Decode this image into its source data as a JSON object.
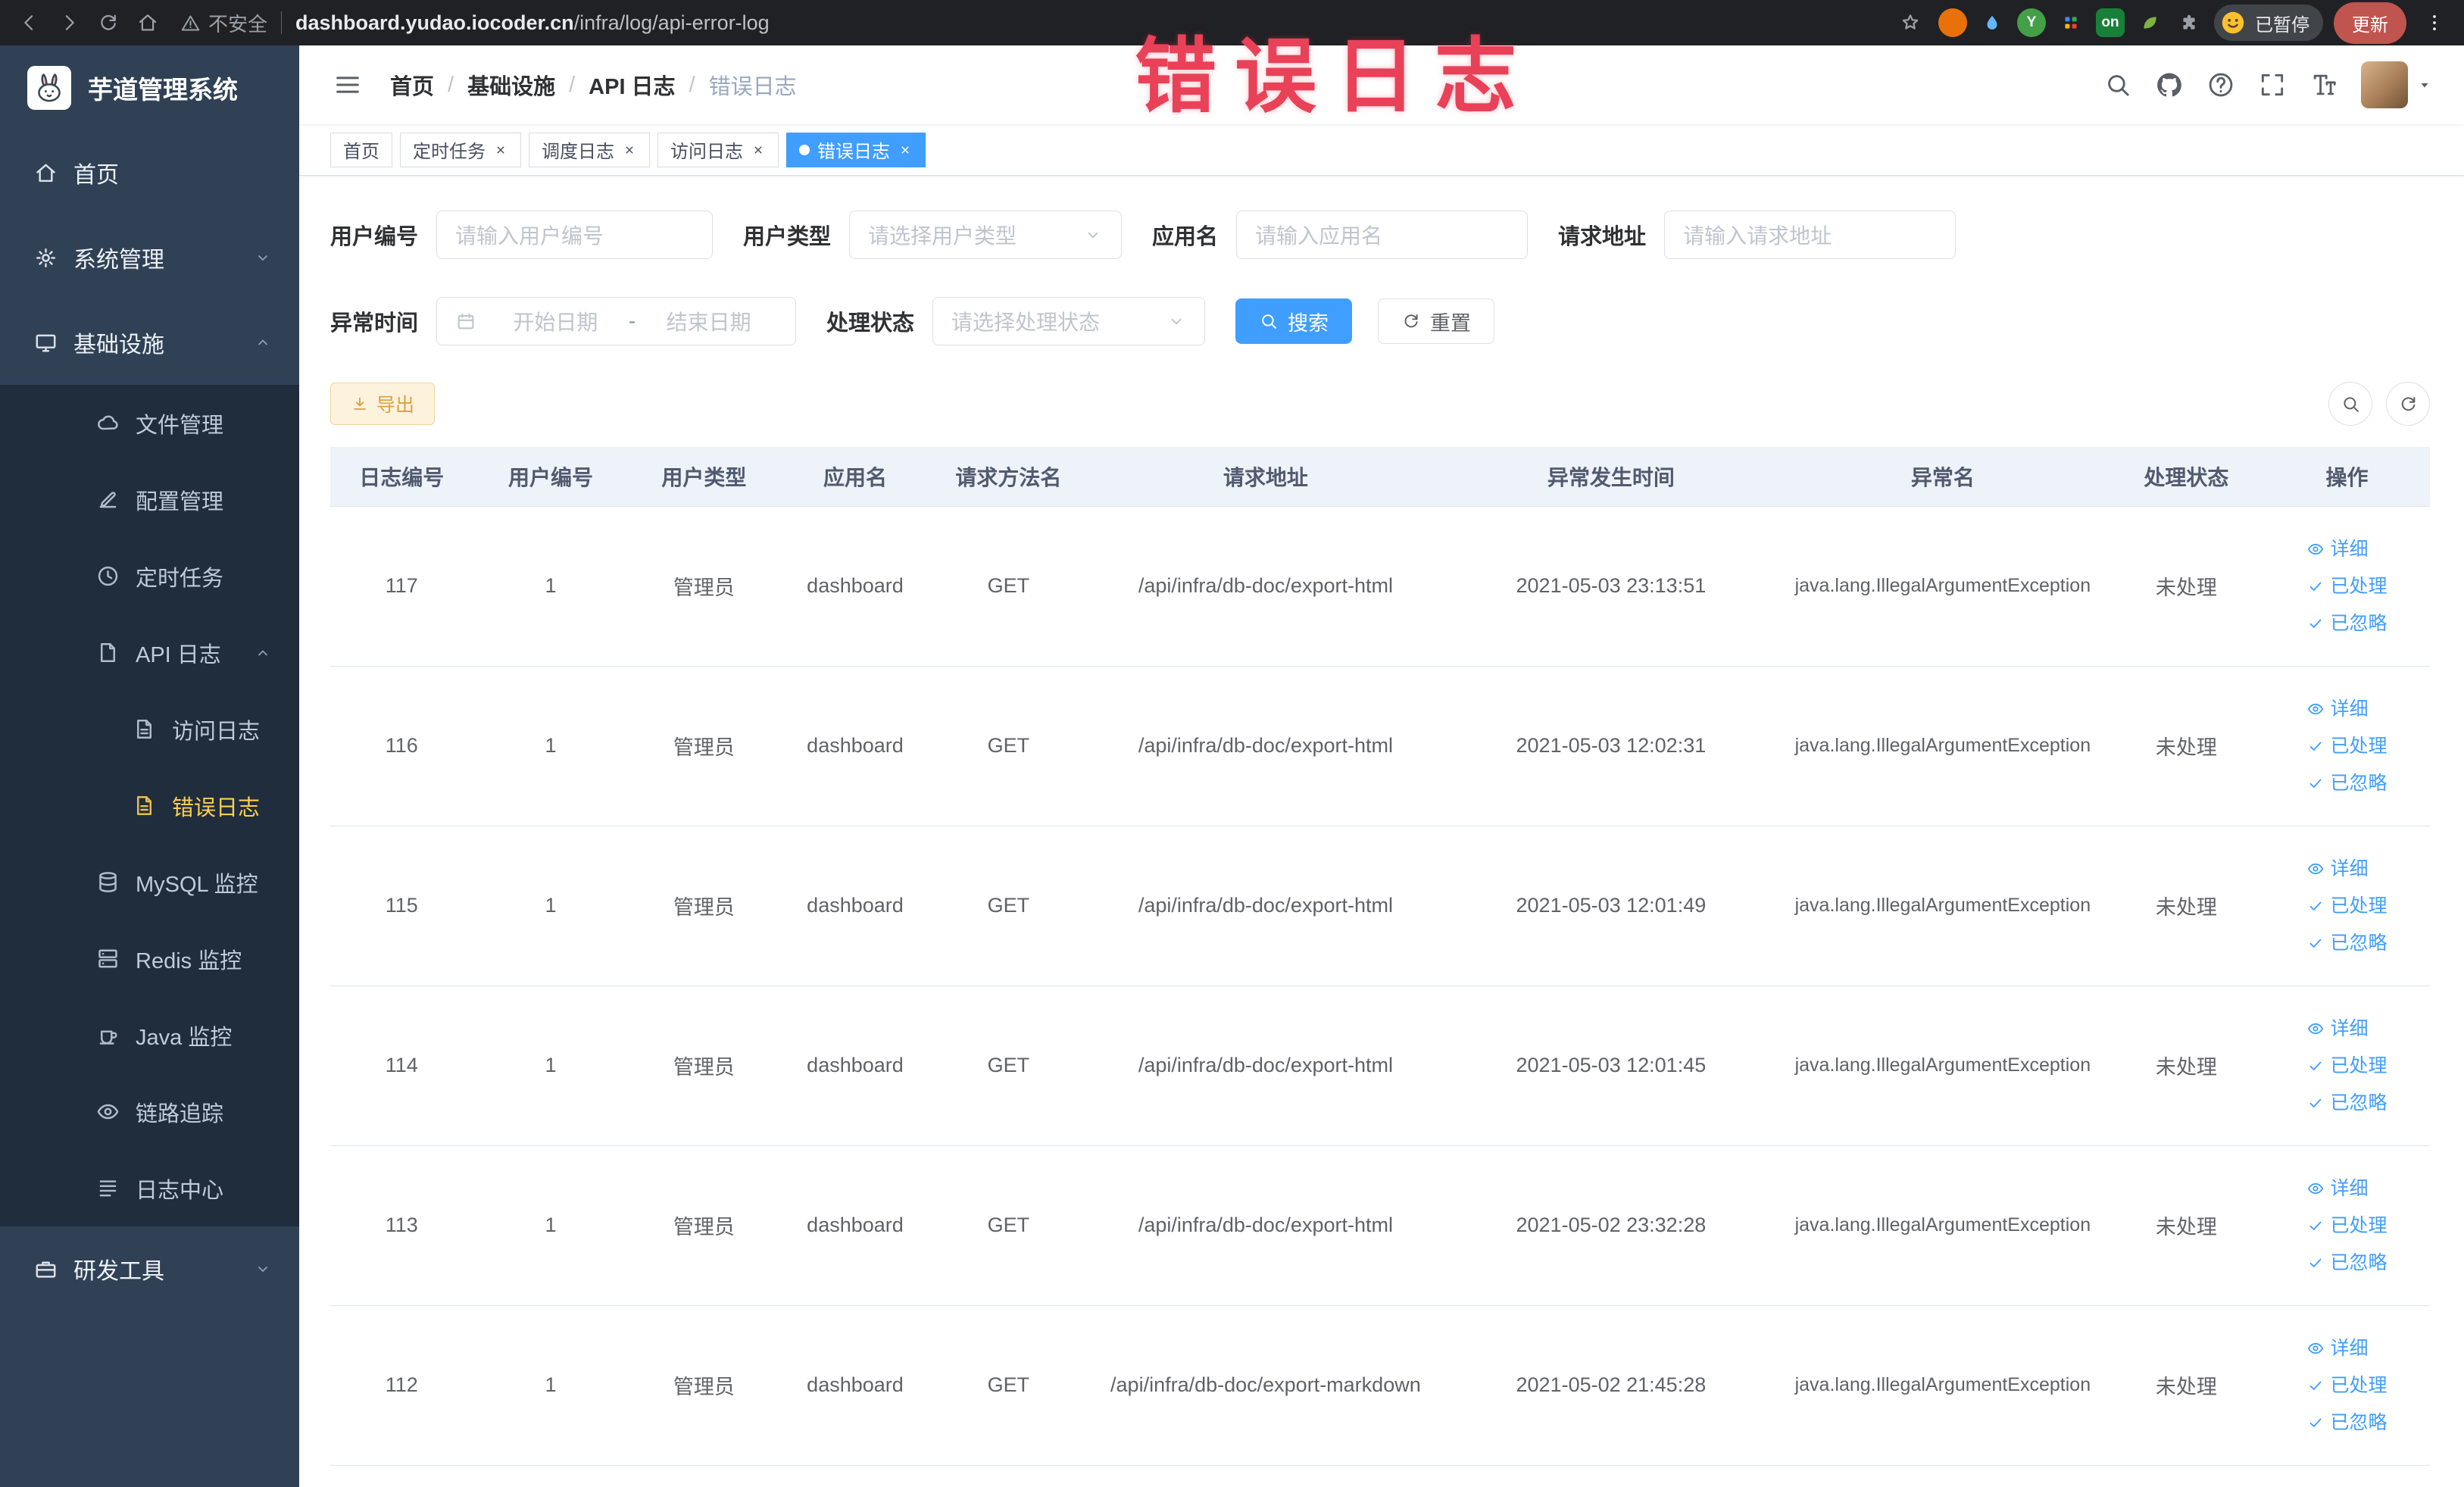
{
  "chrome": {
    "security_label": "不安全",
    "url_domain": "dashboard.yudao.iocoder.cn",
    "url_path": "/infra/log/api-error-log",
    "paused_badge": "已暂停",
    "update_label": "更新"
  },
  "watermark": {
    "text": "错误日志",
    "color": "#e94158"
  },
  "sidebar": {
    "title": "芋道管理系统",
    "items": [
      {
        "key": "home",
        "label": "首页",
        "icon": "home-icon",
        "level": 0
      },
      {
        "key": "system",
        "label": "系统管理",
        "icon": "gear-icon",
        "level": 0,
        "chevron": "down"
      },
      {
        "key": "infrastructure",
        "label": "基础设施",
        "icon": "monitor-icon",
        "level": 0,
        "chevron": "up"
      },
      {
        "key": "file",
        "label": "文件管理",
        "icon": "cloud-icon",
        "level": 1
      },
      {
        "key": "config",
        "label": "配置管理",
        "icon": "edit-icon",
        "level": 1
      },
      {
        "key": "job",
        "label": "定时任务",
        "icon": "clock-icon",
        "level": 1
      },
      {
        "key": "api-log",
        "label": "API 日志",
        "icon": "doc-icon",
        "level": 1,
        "chevron": "up"
      },
      {
        "key": "access-log",
        "label": "访问日志",
        "icon": "doc-lines-icon",
        "level": 2
      },
      {
        "key": "error-log",
        "label": "错误日志",
        "icon": "doc-lines-icon",
        "level": 2,
        "active": true
      },
      {
        "key": "mysql",
        "label": "MySQL 监控",
        "icon": "database-icon",
        "level": 1
      },
      {
        "key": "redis",
        "label": "Redis 监控",
        "icon": "redis-icon",
        "level": 1
      },
      {
        "key": "java",
        "label": "Java 监控",
        "icon": "java-icon",
        "level": 1
      },
      {
        "key": "trace",
        "label": "链路追踪",
        "icon": "eye-icon",
        "level": 1
      },
      {
        "key": "log-center",
        "label": "日志中心",
        "icon": "list-icon",
        "level": 1
      },
      {
        "key": "dev-tools",
        "label": "研发工具",
        "icon": "toolbox-icon",
        "level": 0,
        "chevron": "down"
      }
    ]
  },
  "navbar": {
    "breadcrumb": [
      "首页",
      "基础设施",
      "API 日志",
      "错误日志"
    ]
  },
  "tags": [
    {
      "key": "home",
      "label": "首页",
      "closable": false,
      "active": false
    },
    {
      "key": "job",
      "label": "定时任务",
      "closable": true,
      "active": false
    },
    {
      "key": "job-log",
      "label": "调度日志",
      "closable": true,
      "active": false
    },
    {
      "key": "access-log",
      "label": "访问日志",
      "closable": true,
      "active": false
    },
    {
      "key": "error-log",
      "label": "错误日志",
      "closable": true,
      "active": true
    }
  ],
  "filters": {
    "fields": [
      {
        "key": "userId",
        "label": "用户编号",
        "type": "input",
        "placeholder": "请输入用户编号"
      },
      {
        "key": "userType",
        "label": "用户类型",
        "type": "select",
        "placeholder": "请选择用户类型"
      },
      {
        "key": "appName",
        "label": "应用名",
        "type": "input",
        "placeholder": "请输入应用名"
      },
      {
        "key": "reqUrl",
        "label": "请求地址",
        "type": "input",
        "placeholder": "请输入请求地址"
      },
      {
        "key": "time",
        "label": "异常时间",
        "type": "daterange",
        "start_placeholder": "开始日期",
        "separator": "-",
        "end_placeholder": "结束日期"
      },
      {
        "key": "status",
        "label": "处理状态",
        "type": "select",
        "placeholder": "请选择处理状态"
      }
    ],
    "search_label": "搜索",
    "reset_label": "重置"
  },
  "toolbar": {
    "export_label": "导出"
  },
  "table": {
    "columns": [
      "日志编号",
      "用户编号",
      "用户类型",
      "应用名",
      "请求方法名",
      "请求地址",
      "异常发生时间",
      "异常名",
      "处理状态",
      "操作"
    ],
    "col_keys": [
      "id",
      "user_id",
      "user_type",
      "app",
      "method",
      "url",
      "time",
      "exception",
      "status"
    ],
    "rows": [
      {
        "id": "117",
        "user_id": "1",
        "user_type": "管理员",
        "app": "dashboard",
        "method": "GET",
        "url": "/api/infra/db-doc/export-html",
        "time": "2021-05-03 23:13:51",
        "exception": "java.lang.IllegalArgumentException",
        "status": "未处理"
      },
      {
        "id": "116",
        "user_id": "1",
        "user_type": "管理员",
        "app": "dashboard",
        "method": "GET",
        "url": "/api/infra/db-doc/export-html",
        "time": "2021-05-03 12:02:31",
        "exception": "java.lang.IllegalArgumentException",
        "status": "未处理"
      },
      {
        "id": "115",
        "user_id": "1",
        "user_type": "管理员",
        "app": "dashboard",
        "method": "GET",
        "url": "/api/infra/db-doc/export-html",
        "time": "2021-05-03 12:01:49",
        "exception": "java.lang.IllegalArgumentException",
        "status": "未处理"
      },
      {
        "id": "114",
        "user_id": "1",
        "user_type": "管理员",
        "app": "dashboard",
        "method": "GET",
        "url": "/api/infra/db-doc/export-html",
        "time": "2021-05-03 12:01:45",
        "exception": "java.lang.IllegalArgumentException",
        "status": "未处理"
      },
      {
        "id": "113",
        "user_id": "1",
        "user_type": "管理员",
        "app": "dashboard",
        "method": "GET",
        "url": "/api/infra/db-doc/export-html",
        "time": "2021-05-02 23:32:28",
        "exception": "java.lang.IllegalArgumentException",
        "status": "未处理"
      },
      {
        "id": "112",
        "user_id": "1",
        "user_type": "管理员",
        "app": "dashboard",
        "method": "GET",
        "url": "/api/infra/db-doc/export-markdown",
        "time": "2021-05-02 21:45:28",
        "exception": "java.lang.IllegalArgumentException",
        "status": "未处理"
      }
    ],
    "row_actions": [
      {
        "key": "detail",
        "label": "详细",
        "icon": "eye-icon"
      },
      {
        "key": "processed",
        "label": "已处理",
        "icon": "check-icon"
      },
      {
        "key": "ignored",
        "label": "已忽略",
        "icon": "check-icon"
      }
    ]
  },
  "accent_colors": {
    "primary": "#409eff",
    "menu_active": "#ffd04b",
    "warning": "#e6a23c"
  }
}
